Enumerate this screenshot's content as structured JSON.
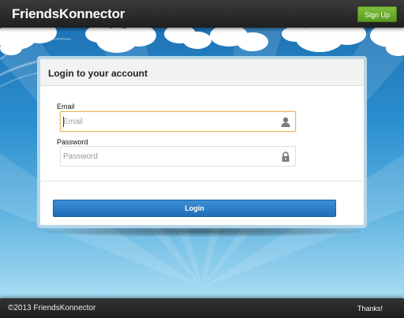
{
  "header": {
    "brand": "FriendsKonnector",
    "signup_label": "Sign Up"
  },
  "login": {
    "title": "Login to your account",
    "email_label": "Email",
    "email_placeholder": "Email",
    "email_value": "",
    "email_icon": "user-icon",
    "password_label": "Password",
    "password_placeholder": "Password",
    "password_value": "",
    "password_icon": "lock-icon",
    "submit_label": "Login"
  },
  "footer": {
    "copyright": "©2013 FriendsKonnector",
    "thanks": "Thanks!"
  },
  "colors": {
    "topbar": "#2b2b2b",
    "signup_button": "#6aab2e",
    "login_button": "#2a7bc6",
    "sky": "#2a8fcd",
    "focus_border": "#e8b75a"
  }
}
